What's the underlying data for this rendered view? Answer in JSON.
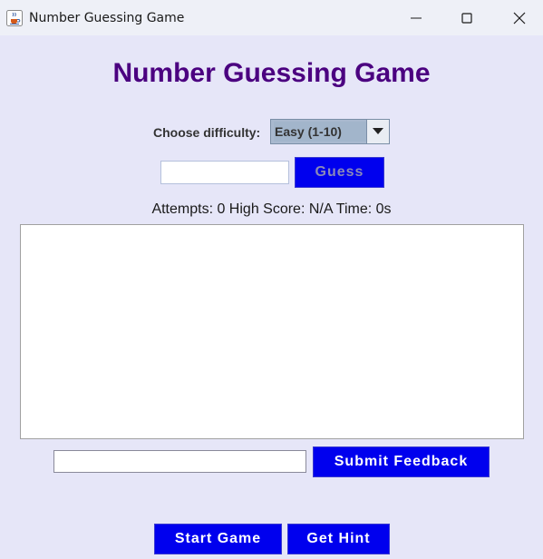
{
  "window": {
    "title": "Number Guessing Game",
    "icon": "java-cup-icon",
    "controls": [
      "minimize-icon",
      "maximize-icon",
      "close-icon"
    ]
  },
  "header": {
    "title": "Number Guessing Game",
    "title_color": "#4b0080"
  },
  "difficulty": {
    "label": "Choose difficulty:",
    "selected": "Easy (1-10)"
  },
  "guess": {
    "input_value": "",
    "button_label": "Guess"
  },
  "status": {
    "text": "Attempts: 0 High Score: N/A Time: 0s"
  },
  "output_area": {
    "text": ""
  },
  "feedback": {
    "input_value": "",
    "button_label": "Submit Feedback"
  },
  "actions": {
    "start_label": "Start Game",
    "hint_label": "Get Hint"
  },
  "colors": {
    "background": "#e6e6f8",
    "button": "#0000ee",
    "button_text": "#ffffff",
    "button_text_disabled": "#8a8ab8"
  }
}
